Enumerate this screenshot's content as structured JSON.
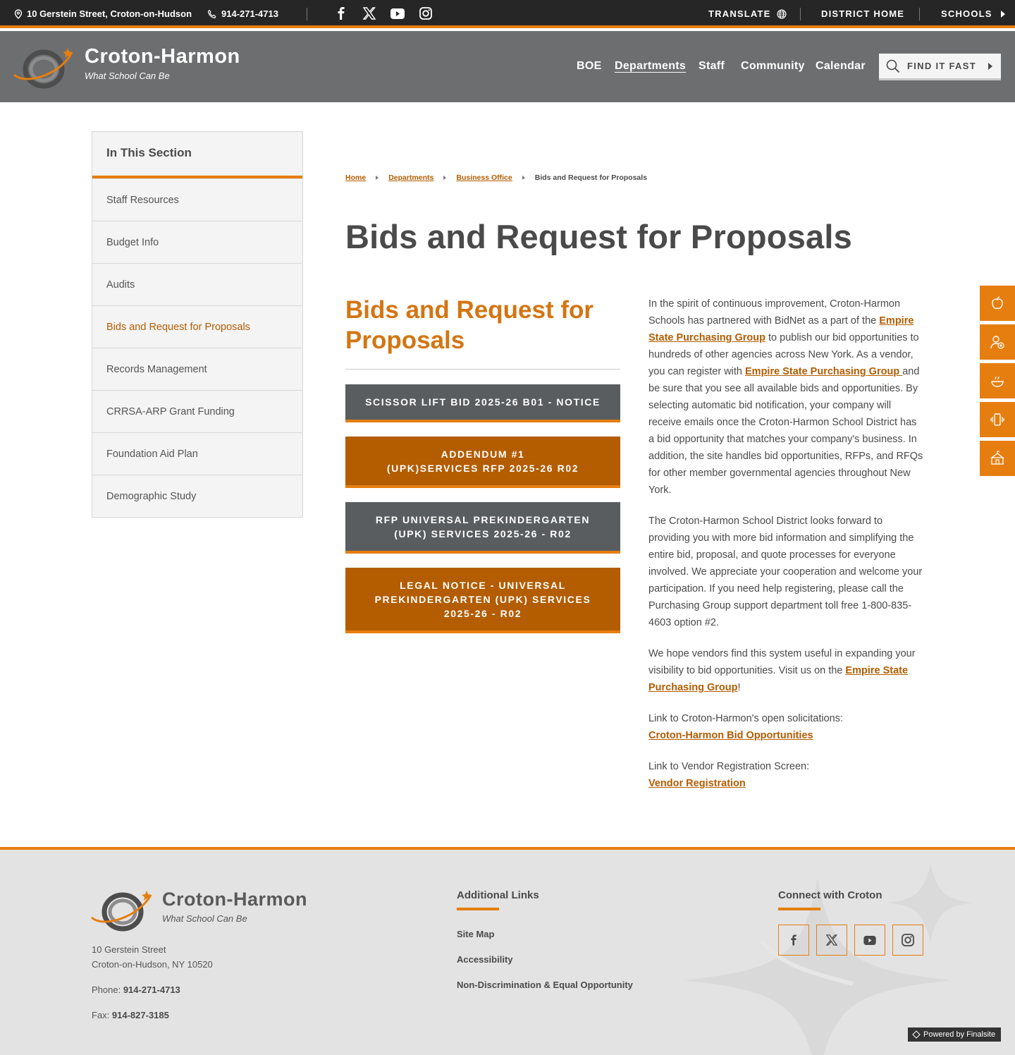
{
  "topbar": {
    "address": "10 Gerstein Street, Croton-on-Hudson",
    "phone": "914-271-4713",
    "translate": "TRANSLATE",
    "district_home": "DISTRICT HOME",
    "schools": "SCHOOLS",
    "social_icons": [
      "facebook-icon",
      "x-icon",
      "youtube-icon",
      "instagram-icon"
    ]
  },
  "header": {
    "brand_name": "Croton-Harmon",
    "brand_tagline": "What School Can Be",
    "nav": [
      "BOE",
      "Departments",
      "Staff",
      "Community",
      "Calendar"
    ],
    "nav_active": "Departments",
    "find_it_fast": "FIND IT FAST"
  },
  "sidebar": {
    "heading": "In This Section",
    "items": [
      "Staff Resources",
      "Budget Info",
      "Audits",
      "Bids and Request for Proposals",
      "Records Management",
      "CRRSA-ARP Grant Funding",
      "Foundation Aid Plan",
      "Demographic Study"
    ],
    "active": "Bids and Request for Proposals"
  },
  "breadcrumb": {
    "items": [
      "Home",
      "Departments",
      "Business Office"
    ],
    "current": "Bids and Request for Proposals"
  },
  "page_title": "Bids and Request for Proposals",
  "section": {
    "title": "Bids and Request for Proposals",
    "buttons": [
      {
        "lines": [
          "SCISSOR LIFT BID 2025-26 B01 - NOTICE"
        ],
        "style": "gray"
      },
      {
        "lines": [
          "ADDENDUM #1",
          "(UPK)SERVICES RFP 2025-26 R02"
        ],
        "style": "orange"
      },
      {
        "lines": [
          "RFP UNIVERSAL PREKINDERGARTEN",
          "(UPK) SERVICES 2025-26 - R02"
        ],
        "style": "gray"
      },
      {
        "lines": [
          "LEGAL NOTICE - UNIVERSAL",
          "PREKINDERGARTEN (UPK) SERVICES",
          "2025-26 - R02"
        ],
        "style": "orange"
      }
    ]
  },
  "body": {
    "p1_a": "In the spirit of continuous improvement, Croton-Harmon Schools has partnered with BidNet as a part of the ",
    "p1_link1": "Empire State Purchasing Group",
    "p1_b": " to publish our bid opportunities to hundreds of other agencies across New York. As a vendor, you can register with ",
    "p1_link2": "Empire State Purchasing Group ",
    "p1_c": "and be sure that you see all available bids and opportunities. By selecting automatic bid notification, your company will receive emails once the Croton-Harmon School District has a bid opportunity that matches your company's business. In addition, the site handles bid opportunities, RFPs, and RFQs for other member governmental agencies throughout New York.",
    "p2": "The Croton-Harmon School District looks forward to providing you with more bid information and simplifying the entire bid, proposal, and quote processes for everyone involved.  We appreciate your cooperation and welcome your participation.  If you need help registering, please call the Purchasing Group support department toll free 1-800-835-4603 option #2.",
    "p3_a": "We hope vendors find this system useful in expanding your visibility to bid opportunities. Visit us on the ",
    "p3_link": "Empire State Purchasing Group",
    "p3_b": "!",
    "p4_label": "Link to Croton-Harmon's open solicitations:",
    "p4_link": "Croton-Harmon Bid Opportunities",
    "p5_label": "Link to Vendor Registration Screen:",
    "p5_link": "Vendor Registration"
  },
  "quick_links": [
    "apple-icon",
    "user-add-icon",
    "food-icon",
    "phone-vibrate-icon",
    "school-icon"
  ],
  "footer": {
    "brand_name": "Croton-Harmon",
    "brand_tagline": "What School Can Be",
    "address_line1": "10 Gerstein Street",
    "address_line2": "Croton-on-Hudson, NY  10520",
    "phone_label": "Phone: ",
    "phone": "914-271-4713",
    "fax_label": "Fax: ",
    "fax": "914-827-3185",
    "links_heading": "Additional Links",
    "links": [
      "Site Map",
      "Accessibility",
      "Non-Discrimination & Equal Opportunity"
    ],
    "connect_heading": "Connect with Croton",
    "powered_by": "Powered by Finalsite"
  },
  "colors": {
    "accent": "#e67e0f",
    "accent_dark": "#b35c00",
    "header_bg": "#6d6e6f",
    "topbar_bg": "#262626"
  }
}
